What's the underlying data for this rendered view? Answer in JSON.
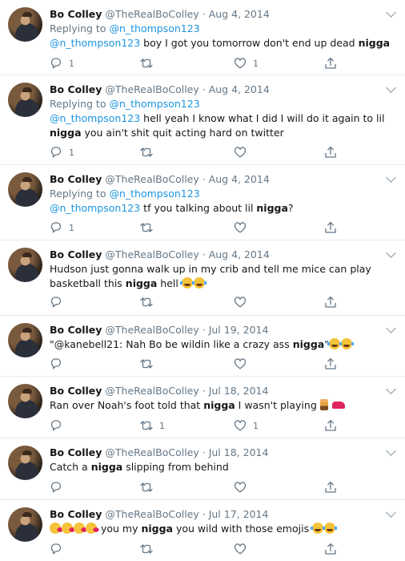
{
  "colors": {
    "link": "#1b95e0",
    "muted": "#657786",
    "divider": "#e6ecf0"
  },
  "icons": {
    "reply": "reply-icon",
    "retweet": "retweet-icon",
    "like": "heart-icon",
    "share": "share-icon",
    "menu": "chevron-down-icon"
  },
  "tweets": [
    {
      "name": "Bo Colley",
      "handle": "@TheRealBoColley",
      "dot": "·",
      "date": "Aug 4, 2014",
      "replying_to_label": "Replying to",
      "replying_to_user": "@n_thompson123",
      "body": {
        "mention": "@n_thompson123",
        "pre": " boy I got you tomorrow don't end up dead ",
        "bold": "nigga",
        "post": ""
      },
      "reply_count": "1",
      "retweet_count": "",
      "like_count": "1"
    },
    {
      "name": "Bo Colley",
      "handle": "@TheRealBoColley",
      "dot": "·",
      "date": "Aug 4, 2014",
      "replying_to_label": "Replying to",
      "replying_to_user": "@n_thompson123",
      "body": {
        "mention": "@n_thompson123",
        "pre": " hell yeah I know what I did I will do it again to lil ",
        "bold": "nigga",
        "post": " you ain't shit quit acting hard on twitter"
      },
      "reply_count": "1",
      "retweet_count": "",
      "like_count": ""
    },
    {
      "name": "Bo Colley",
      "handle": "@TheRealBoColley",
      "dot": "·",
      "date": "Aug 4, 2014",
      "replying_to_label": "Replying to",
      "replying_to_user": "@n_thompson123",
      "body": {
        "mention": "@n_thompson123",
        "pre": " tf you talking about lil ",
        "bold": "nigga",
        "post": "?"
      },
      "reply_count": "1",
      "retweet_count": "",
      "like_count": ""
    },
    {
      "name": "Bo Colley",
      "handle": "@TheRealBoColley",
      "dot": "·",
      "date": "Aug 4, 2014",
      "body": {
        "mention": "",
        "pre": "Hudson just gonna walk up in my crib and tell me mice can play basketball this ",
        "bold": "nigga",
        "post": " hell "
      },
      "reply_count": "",
      "retweet_count": "",
      "like_count": ""
    },
    {
      "name": "Bo Colley",
      "handle": "@TheRealBoColley",
      "dot": "·",
      "date": "Jul 19, 2014",
      "body": {
        "mention": "",
        "pre": "\"@kanebell21: Nah Bo be wildin like a crazy ass ",
        "bold": "nigga",
        "post": "\""
      },
      "reply_count": "",
      "retweet_count": "",
      "like_count": ""
    },
    {
      "name": "Bo Colley",
      "handle": "@TheRealBoColley",
      "dot": "·",
      "date": "Jul 18, 2014",
      "body": {
        "mention": "",
        "pre": "Ran over Noah's foot told that ",
        "bold": "nigga",
        "post": " I wasn't playing "
      },
      "reply_count": "",
      "retweet_count": "1",
      "like_count": "1"
    },
    {
      "name": "Bo Colley",
      "handle": "@TheRealBoColley",
      "dot": "·",
      "date": "Jul 18, 2014",
      "body": {
        "mention": "",
        "pre": "Catch a ",
        "bold": "nigga",
        "post": " slipping from behind"
      },
      "reply_count": "",
      "retweet_count": "",
      "like_count": ""
    },
    {
      "name": "Bo Colley",
      "handle": "@TheRealBoColley",
      "dot": "·",
      "date": "Jul 17, 2014",
      "body": {
        "mention": "",
        "pre": " you my ",
        "bold": "nigga",
        "post": " you wild with those emojis "
      },
      "reply_count": "",
      "retweet_count": "",
      "like_count": ""
    }
  ]
}
